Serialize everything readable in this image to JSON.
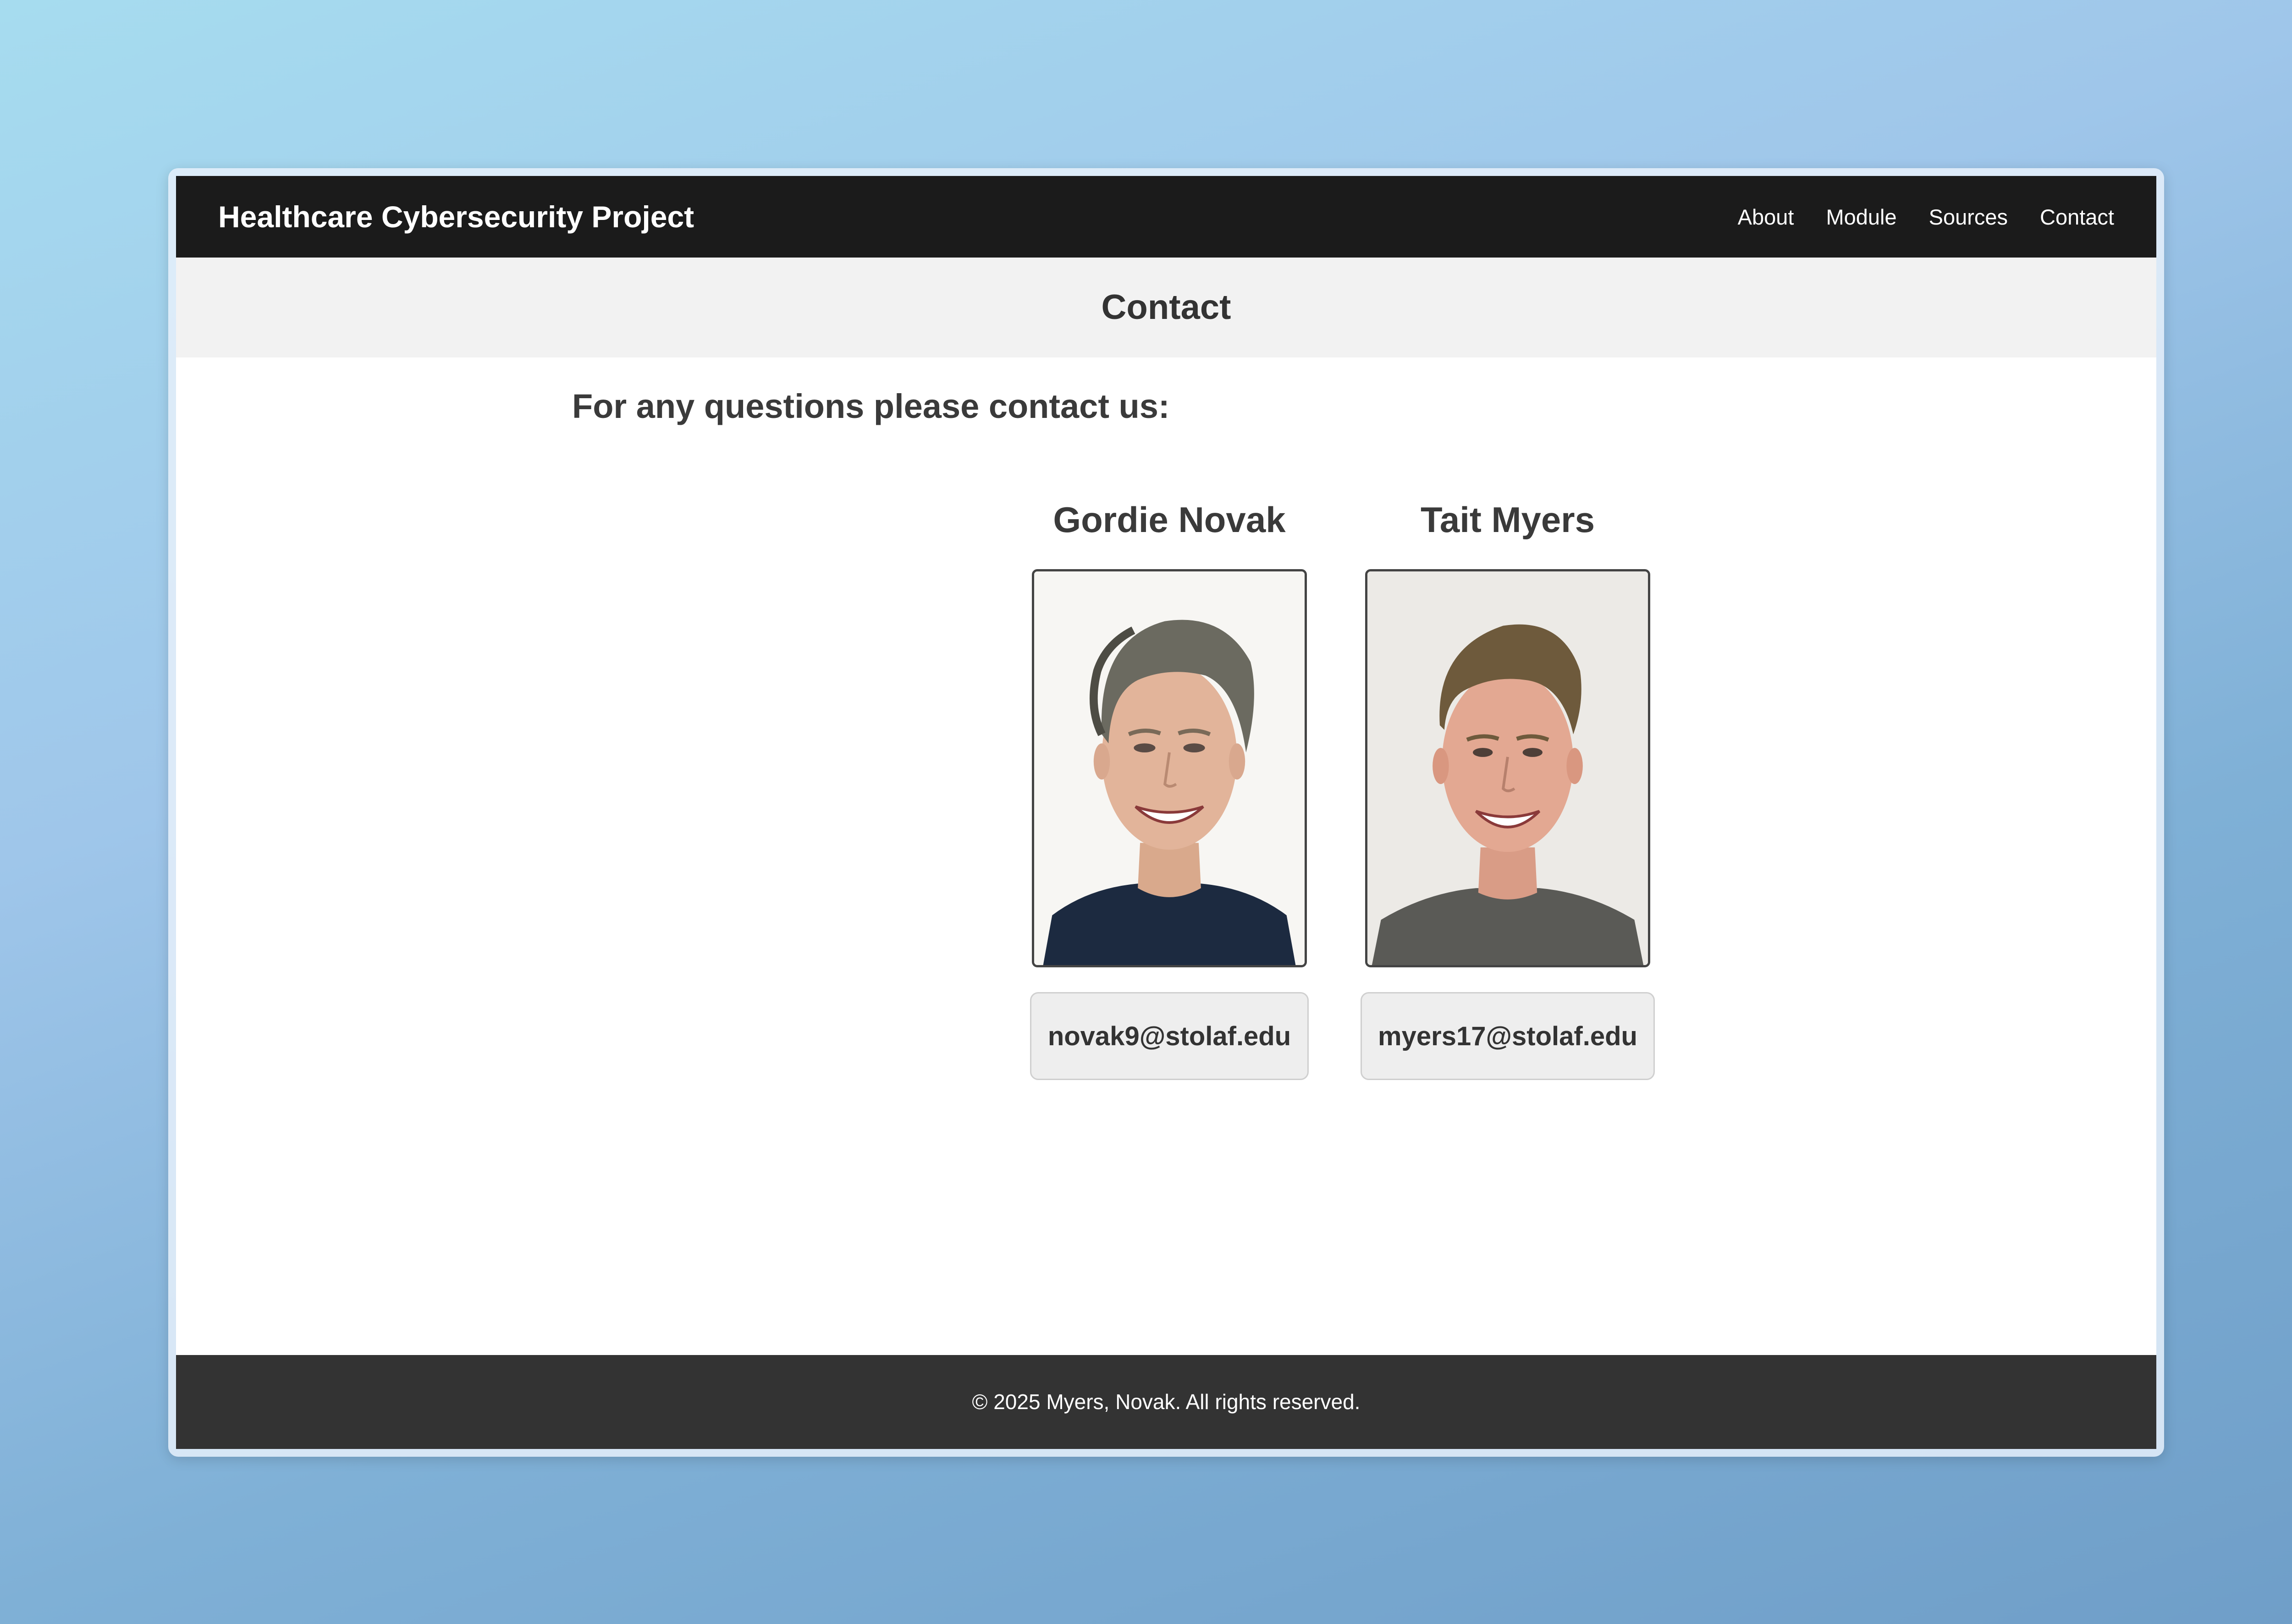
{
  "navbar": {
    "brand": "Healthcare Cybersecurity Project",
    "links": [
      "About",
      "Module",
      "Sources",
      "Contact"
    ]
  },
  "header": {
    "title": "Contact"
  },
  "main": {
    "intro": "For any questions please contact us:",
    "people": [
      {
        "name": "Gordie Novak",
        "email": "novak9@stolaf.edu",
        "photo_icon": "portrait-photo"
      },
      {
        "name": "Tait Myers",
        "email": "myers17@stolaf.edu",
        "photo_icon": "portrait-photo"
      }
    ]
  },
  "footer": {
    "text": "© 2025 Myers, Novak. All rights reserved."
  },
  "colors": {
    "navbar_bg": "#1b1b1b",
    "title_band_bg": "#f2f2f2",
    "footer_bg": "#333333",
    "email_box_bg": "#eeeeee"
  }
}
